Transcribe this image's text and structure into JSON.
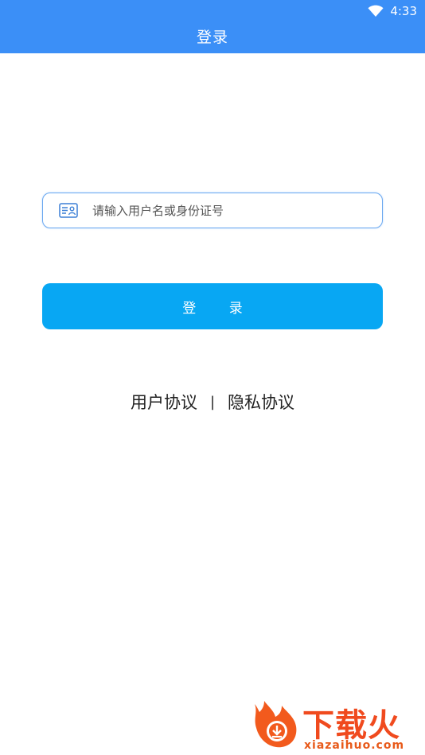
{
  "status_bar": {
    "time": "4:33",
    "wifi_icon": "wifi-icon"
  },
  "header": {
    "title": "登录",
    "background": "#3b8ff7"
  },
  "login_form": {
    "id_field": {
      "icon": "id-card-icon",
      "placeholder": "请输入用户名或身份证号",
      "value": ""
    },
    "submit_label": "登 录",
    "button_color": "#08a7f3"
  },
  "agreements": {
    "user_agreement": "用户协议",
    "separator": "|",
    "privacy_policy": "隐私协议"
  },
  "watermark": {
    "brand": "下载火",
    "domain": "xiazaihuo.com",
    "color": "#f04a1e"
  }
}
